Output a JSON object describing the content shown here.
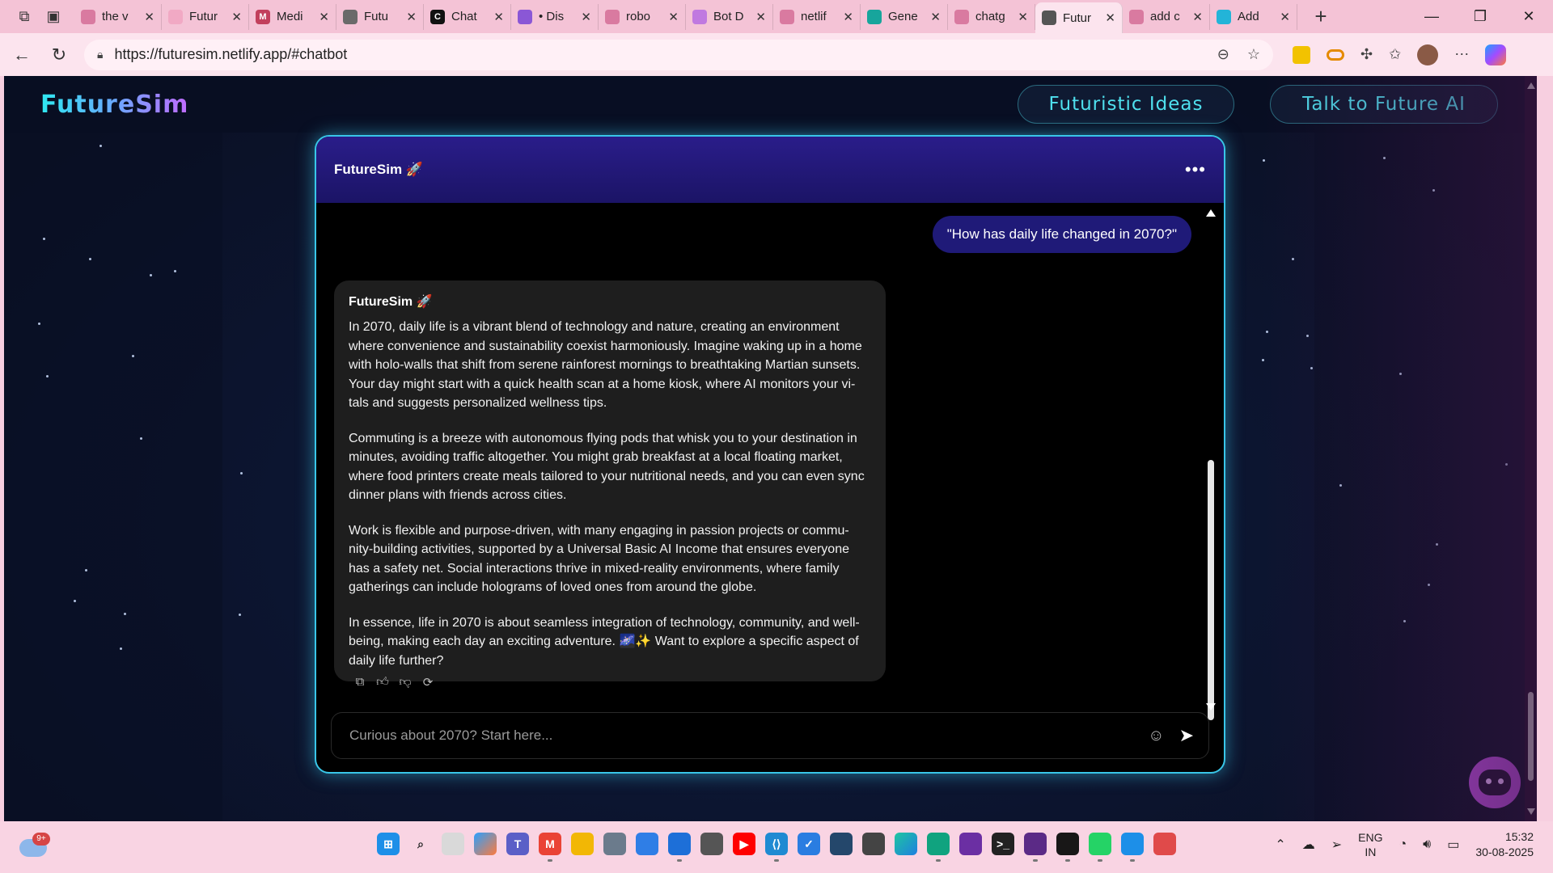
{
  "browser": {
    "tabs": [
      {
        "label": "the v",
        "fav": "search",
        "color": "#d97aa0"
      },
      {
        "label": "Futur",
        "fav": "site",
        "color": "#f1a9c4"
      },
      {
        "label": "Medi",
        "fav": "M",
        "color": "#c2405d"
      },
      {
        "label": "Futu",
        "fav": "globe",
        "color": "#6a6a6a"
      },
      {
        "label": "Chat",
        "fav": "C",
        "color": "#111111"
      },
      {
        "label": "• Dis",
        "fav": "discord",
        "color": "#8a57d6"
      },
      {
        "label": "robo",
        "fav": "search",
        "color": "#d97aa0"
      },
      {
        "label": "Bot D",
        "fav": "grid",
        "color": "#c079e0"
      },
      {
        "label": "netlif",
        "fav": "search",
        "color": "#d97aa0"
      },
      {
        "label": "Gene",
        "fav": "diamond",
        "color": "#17a59c"
      },
      {
        "label": "chatg",
        "fav": "search",
        "color": "#d97aa0"
      },
      {
        "label": "Futur",
        "fav": "globe",
        "color": "#555555",
        "active": true
      },
      {
        "label": "add c",
        "fav": "search",
        "color": "#d97aa0"
      },
      {
        "label": "Add",
        "fav": "play",
        "color": "#23b4d8"
      }
    ],
    "url": "https://futuresim.netlify.app/#chatbot"
  },
  "site": {
    "logo": "FutureSim",
    "nav": [
      "Futuristic Ideas",
      "Talk to Future AI"
    ]
  },
  "chat": {
    "title": "FutureSim 🚀",
    "menu": "•••",
    "user_message": "\"How has daily life changed in 2070?\"",
    "bot_name": "FutureSim 🚀",
    "bot_paragraphs": [
      "In 2070, daily life is a vibrant blend of technology and nature, creating an environment where convenience and sustainability coexist harmoniously. Imagine waking up in a home with holo-walls that shift from serene rainforest mornings to breathtaking Martian sunsets. Your day might start with a quick health scan at a home kiosk, where AI monitors your vi-tals and suggests personalized wellness tips.",
      "Commuting is a breeze with autonomous flying pods that whisk you to your destination in minutes, avoiding traffic altogether. You might grab breakfast at a local floating market, where food printers create meals tailored to your nutritional needs, and you can even sync dinner plans with friends across cities.",
      "Work is flexible and purpose-driven, with many engaging in passion projects or commu-nity-building activities, supported by a Universal Basic AI Income that ensures everyone has a safety net. Social interactions thrive in mixed-reality environments, where family gatherings can include holograms of loved ones from around the globe.",
      "In essence, life in 2070 is about seamless integration of technology, community, and well-being, making each day an exciting adventure. 🌌✨ Want to explore a specific aspect of daily life further?"
    ],
    "input_placeholder": "Curious about 2070? Start here..."
  },
  "colors": {
    "accent_cyan": "#39c6e8",
    "header_purple": "#2a1d8a",
    "user_bubble": "#1f1a78",
    "bot_bubble": "#1e1e1e"
  },
  "taskbar": {
    "weather_badge": "9+",
    "lang_top": "ENG",
    "lang_bottom": "IN",
    "time": "15:32",
    "date": "30-08-2025"
  }
}
